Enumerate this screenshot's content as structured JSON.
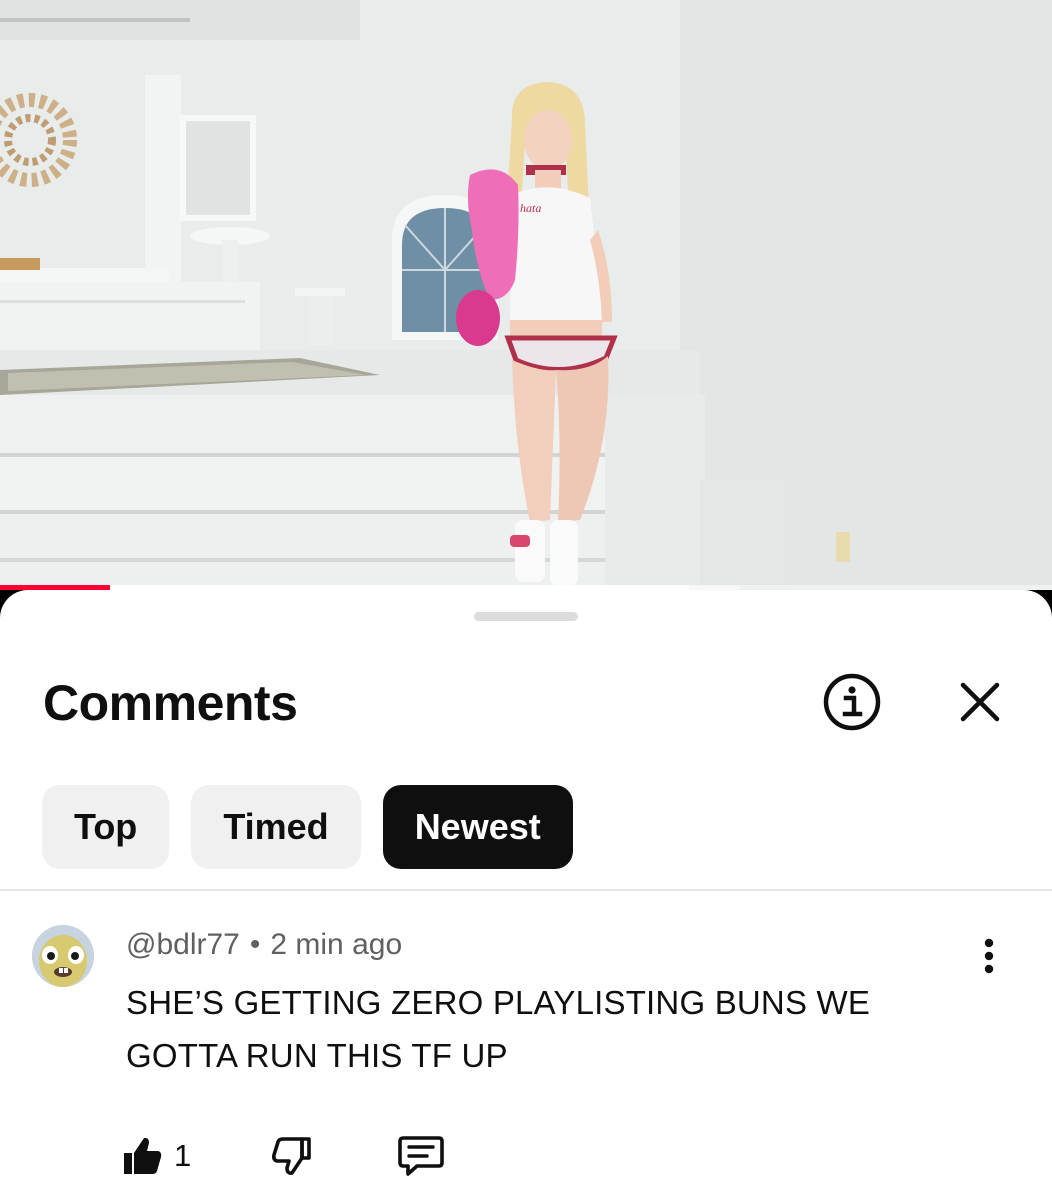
{
  "video": {
    "progress_played": 0.105,
    "progress_buffered": 0.655
  },
  "comments_panel": {
    "title": "Comments",
    "info_icon": "info-circle-icon",
    "close_icon": "close-x-icon"
  },
  "sort_chips": [
    {
      "label": "Top",
      "active": false
    },
    {
      "label": "Timed",
      "active": false
    },
    {
      "label": "Newest",
      "active": true
    }
  ],
  "comment": {
    "author": "@bdlr77",
    "separator": "•",
    "time": "2 min ago",
    "text": "SHE’S GETTING ZERO PLAYLISTING BUNS WE GOTTA RUN THIS TF UP",
    "likes": "1"
  },
  "colors": {
    "accent_red": "#ff0033",
    "chip_active_bg": "#0f0f0f",
    "chip_bg": "#f0f0f0",
    "meta_text": "#606060"
  }
}
